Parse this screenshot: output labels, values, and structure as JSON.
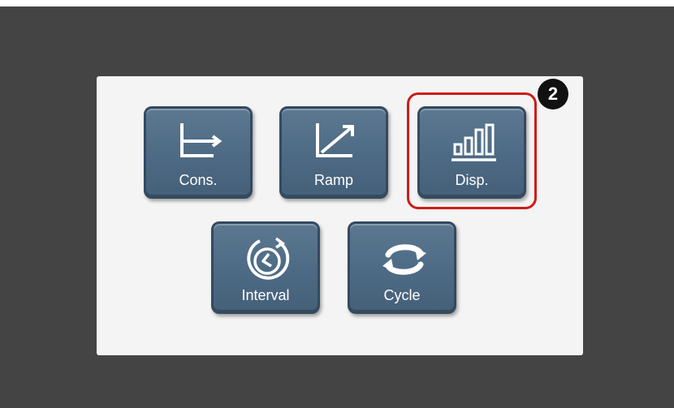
{
  "buttons": [
    {
      "label": "Cons.",
      "icon": "constant-flow-icon"
    },
    {
      "label": "Ramp",
      "icon": "ramp-icon"
    },
    {
      "label": "Disp.",
      "icon": "bar-chart-icon"
    },
    {
      "label": "Interval",
      "icon": "interval-clock-icon"
    },
    {
      "label": "Cycle",
      "icon": "cycle-arrows-icon"
    }
  ],
  "callout": {
    "number": "2",
    "highlighted_button": "Disp."
  },
  "colors": {
    "background": "#444444",
    "panel": "#f4f4f4",
    "button": "#4d6a84",
    "highlight": "#d11a1a",
    "badge": "#111111"
  }
}
